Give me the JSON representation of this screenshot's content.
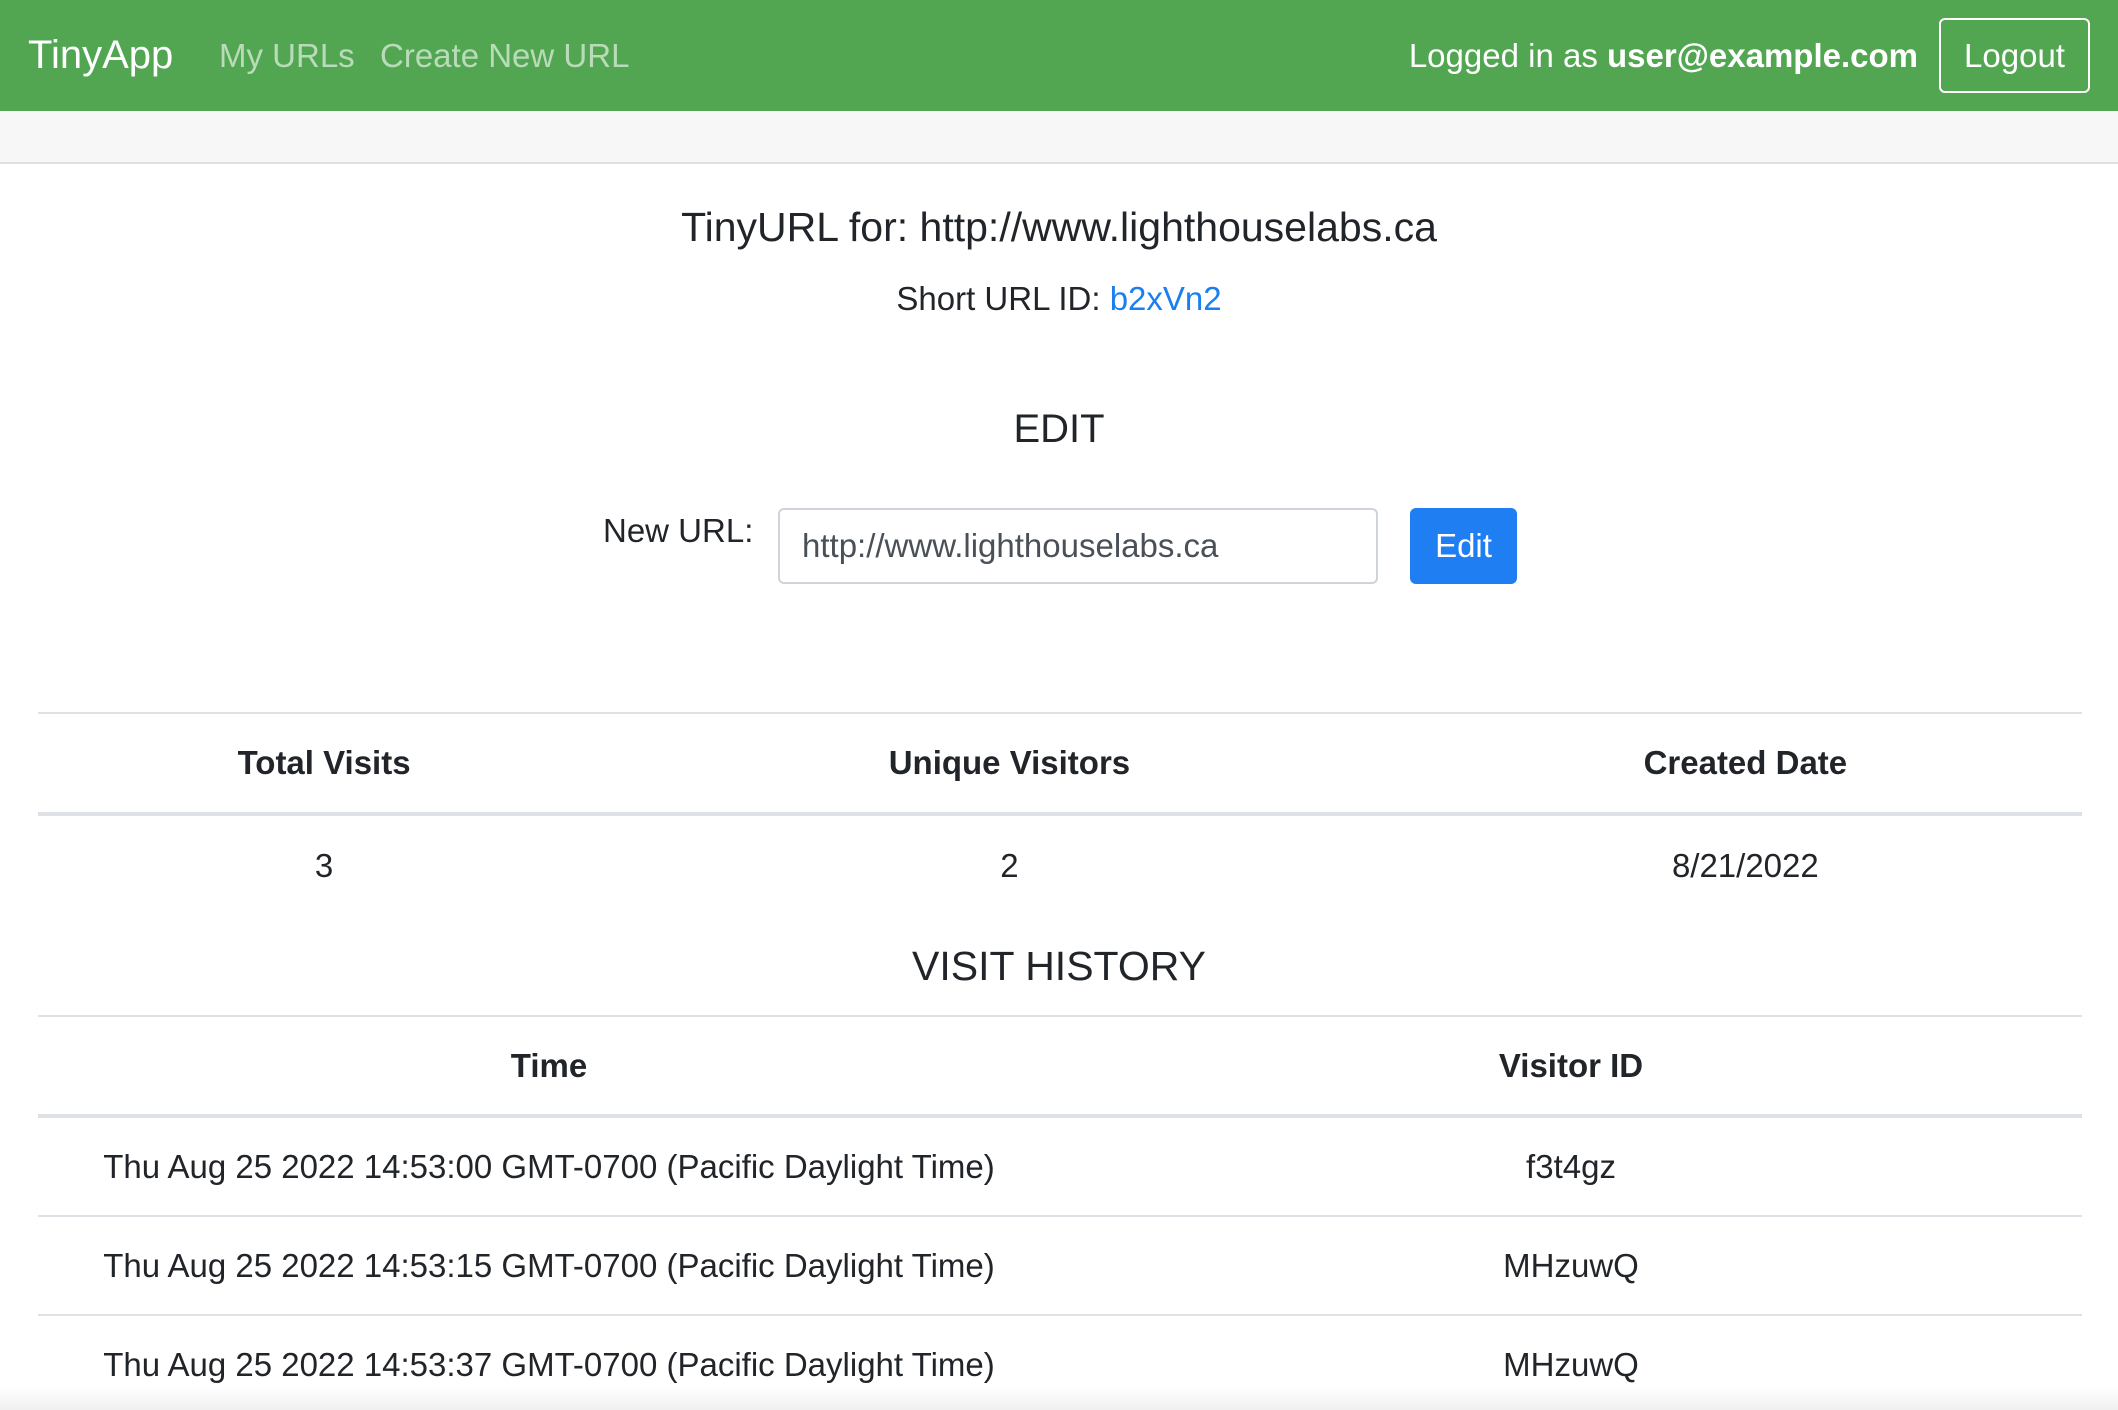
{
  "navbar": {
    "brand": "TinyApp",
    "links": [
      {
        "label": "My URLs"
      },
      {
        "label": "Create New URL"
      }
    ],
    "login_prefix": "Logged in as ",
    "user_email": "user@example.com",
    "logout_label": "Logout",
    "background": "#52a652"
  },
  "url_detail": {
    "title": "TinyURL for: http://www.lighthouselabs.ca",
    "short_id_label": "Short URL ID: ",
    "short_id": "b2xVn2"
  },
  "edit": {
    "heading": "EDIT",
    "label": "New URL:",
    "value": "http://www.lighthouselabs.ca",
    "button_label": "Edit",
    "button_color": "#1f7ef2"
  },
  "stats": {
    "headers": [
      "Total Visits",
      "Unique Visitors",
      "Created Date"
    ],
    "values": [
      "3",
      "2",
      "8/21/2022"
    ]
  },
  "history": {
    "heading": "VISIT HISTORY",
    "headers": [
      "Time",
      "Visitor ID"
    ],
    "rows": [
      {
        "time": "Thu Aug 25 2022 14:53:00 GMT-0700 (Pacific Daylight Time)",
        "visitor": "f3t4gz"
      },
      {
        "time": "Thu Aug 25 2022 14:53:15 GMT-0700 (Pacific Daylight Time)",
        "visitor": "MHzuwQ"
      },
      {
        "time": "Thu Aug 25 2022 14:53:37 GMT-0700 (Pacific Daylight Time)",
        "visitor": "MHzuwQ"
      }
    ]
  }
}
